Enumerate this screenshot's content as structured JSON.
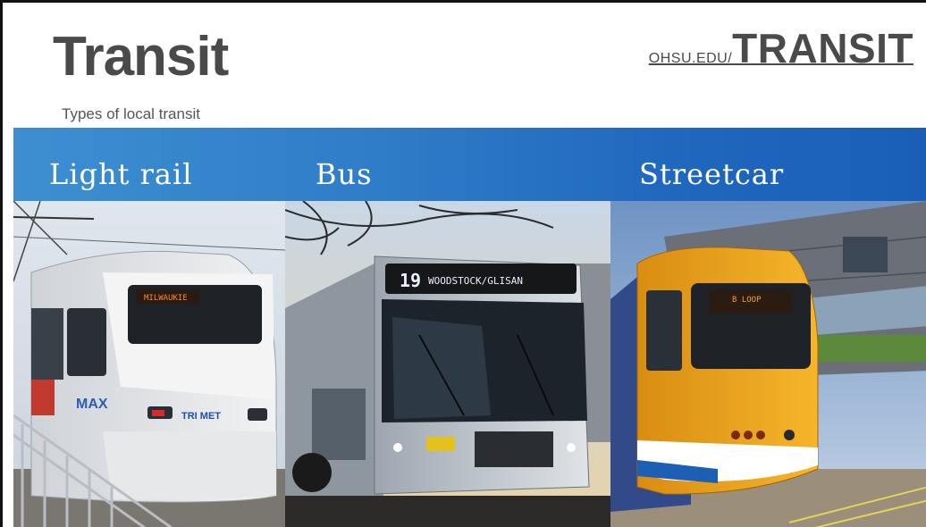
{
  "slide": {
    "title": "Transit",
    "subtitle": "Types of local transit",
    "link_prefix": "OHSU.EDU/",
    "link_main": "TRANSIT"
  },
  "categories": [
    {
      "label": "Light rail"
    },
    {
      "label": "Bus"
    },
    {
      "label": "Streetcar"
    }
  ],
  "photos": {
    "light_rail": {
      "sign": "MILWAUKIE",
      "side_text": "MAX",
      "brand": "TRI MET"
    },
    "bus": {
      "route": "19",
      "sign": "WOODSTOCK/GLISAN"
    },
    "streetcar": {
      "sign": "B LOOP"
    }
  },
  "colors": {
    "band_start": "#3d8fd1",
    "band_end": "#1a5eb8",
    "streetcar_yellow": "#f2a81d",
    "title_gray": "#4a4a4a"
  }
}
